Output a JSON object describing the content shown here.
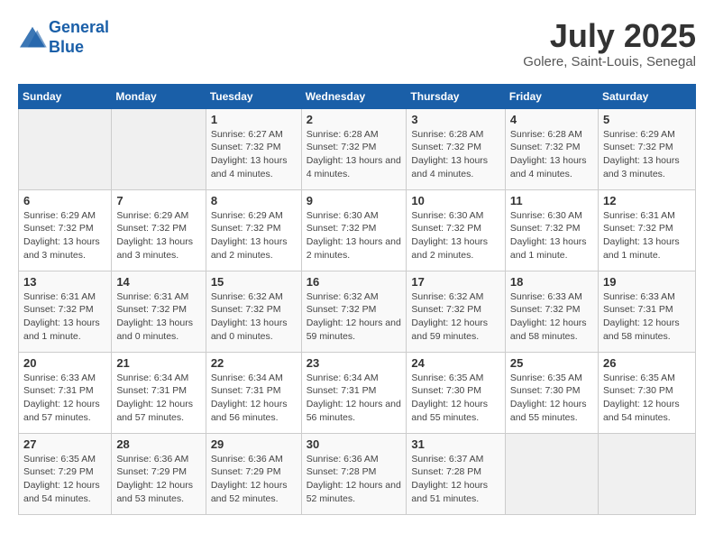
{
  "header": {
    "logo_line1": "General",
    "logo_line2": "Blue",
    "month_year": "July 2025",
    "location": "Golere, Saint-Louis, Senegal"
  },
  "weekdays": [
    "Sunday",
    "Monday",
    "Tuesday",
    "Wednesday",
    "Thursday",
    "Friday",
    "Saturday"
  ],
  "weeks": [
    [
      {
        "day": "",
        "info": ""
      },
      {
        "day": "",
        "info": ""
      },
      {
        "day": "1",
        "info": "Sunrise: 6:27 AM\nSunset: 7:32 PM\nDaylight: 13 hours and 4 minutes."
      },
      {
        "day": "2",
        "info": "Sunrise: 6:28 AM\nSunset: 7:32 PM\nDaylight: 13 hours and 4 minutes."
      },
      {
        "day": "3",
        "info": "Sunrise: 6:28 AM\nSunset: 7:32 PM\nDaylight: 13 hours and 4 minutes."
      },
      {
        "day": "4",
        "info": "Sunrise: 6:28 AM\nSunset: 7:32 PM\nDaylight: 13 hours and 4 minutes."
      },
      {
        "day": "5",
        "info": "Sunrise: 6:29 AM\nSunset: 7:32 PM\nDaylight: 13 hours and 3 minutes."
      }
    ],
    [
      {
        "day": "6",
        "info": "Sunrise: 6:29 AM\nSunset: 7:32 PM\nDaylight: 13 hours and 3 minutes."
      },
      {
        "day": "7",
        "info": "Sunrise: 6:29 AM\nSunset: 7:32 PM\nDaylight: 13 hours and 3 minutes."
      },
      {
        "day": "8",
        "info": "Sunrise: 6:29 AM\nSunset: 7:32 PM\nDaylight: 13 hours and 2 minutes."
      },
      {
        "day": "9",
        "info": "Sunrise: 6:30 AM\nSunset: 7:32 PM\nDaylight: 13 hours and 2 minutes."
      },
      {
        "day": "10",
        "info": "Sunrise: 6:30 AM\nSunset: 7:32 PM\nDaylight: 13 hours and 2 minutes."
      },
      {
        "day": "11",
        "info": "Sunrise: 6:30 AM\nSunset: 7:32 PM\nDaylight: 13 hours and 1 minute."
      },
      {
        "day": "12",
        "info": "Sunrise: 6:31 AM\nSunset: 7:32 PM\nDaylight: 13 hours and 1 minute."
      }
    ],
    [
      {
        "day": "13",
        "info": "Sunrise: 6:31 AM\nSunset: 7:32 PM\nDaylight: 13 hours and 1 minute."
      },
      {
        "day": "14",
        "info": "Sunrise: 6:31 AM\nSunset: 7:32 PM\nDaylight: 13 hours and 0 minutes."
      },
      {
        "day": "15",
        "info": "Sunrise: 6:32 AM\nSunset: 7:32 PM\nDaylight: 13 hours and 0 minutes."
      },
      {
        "day": "16",
        "info": "Sunrise: 6:32 AM\nSunset: 7:32 PM\nDaylight: 12 hours and 59 minutes."
      },
      {
        "day": "17",
        "info": "Sunrise: 6:32 AM\nSunset: 7:32 PM\nDaylight: 12 hours and 59 minutes."
      },
      {
        "day": "18",
        "info": "Sunrise: 6:33 AM\nSunset: 7:32 PM\nDaylight: 12 hours and 58 minutes."
      },
      {
        "day": "19",
        "info": "Sunrise: 6:33 AM\nSunset: 7:31 PM\nDaylight: 12 hours and 58 minutes."
      }
    ],
    [
      {
        "day": "20",
        "info": "Sunrise: 6:33 AM\nSunset: 7:31 PM\nDaylight: 12 hours and 57 minutes."
      },
      {
        "day": "21",
        "info": "Sunrise: 6:34 AM\nSunset: 7:31 PM\nDaylight: 12 hours and 57 minutes."
      },
      {
        "day": "22",
        "info": "Sunrise: 6:34 AM\nSunset: 7:31 PM\nDaylight: 12 hours and 56 minutes."
      },
      {
        "day": "23",
        "info": "Sunrise: 6:34 AM\nSunset: 7:31 PM\nDaylight: 12 hours and 56 minutes."
      },
      {
        "day": "24",
        "info": "Sunrise: 6:35 AM\nSunset: 7:30 PM\nDaylight: 12 hours and 55 minutes."
      },
      {
        "day": "25",
        "info": "Sunrise: 6:35 AM\nSunset: 7:30 PM\nDaylight: 12 hours and 55 minutes."
      },
      {
        "day": "26",
        "info": "Sunrise: 6:35 AM\nSunset: 7:30 PM\nDaylight: 12 hours and 54 minutes."
      }
    ],
    [
      {
        "day": "27",
        "info": "Sunrise: 6:35 AM\nSunset: 7:29 PM\nDaylight: 12 hours and 54 minutes."
      },
      {
        "day": "28",
        "info": "Sunrise: 6:36 AM\nSunset: 7:29 PM\nDaylight: 12 hours and 53 minutes."
      },
      {
        "day": "29",
        "info": "Sunrise: 6:36 AM\nSunset: 7:29 PM\nDaylight: 12 hours and 52 minutes."
      },
      {
        "day": "30",
        "info": "Sunrise: 6:36 AM\nSunset: 7:28 PM\nDaylight: 12 hours and 52 minutes."
      },
      {
        "day": "31",
        "info": "Sunrise: 6:37 AM\nSunset: 7:28 PM\nDaylight: 12 hours and 51 minutes."
      },
      {
        "day": "",
        "info": ""
      },
      {
        "day": "",
        "info": ""
      }
    ]
  ]
}
